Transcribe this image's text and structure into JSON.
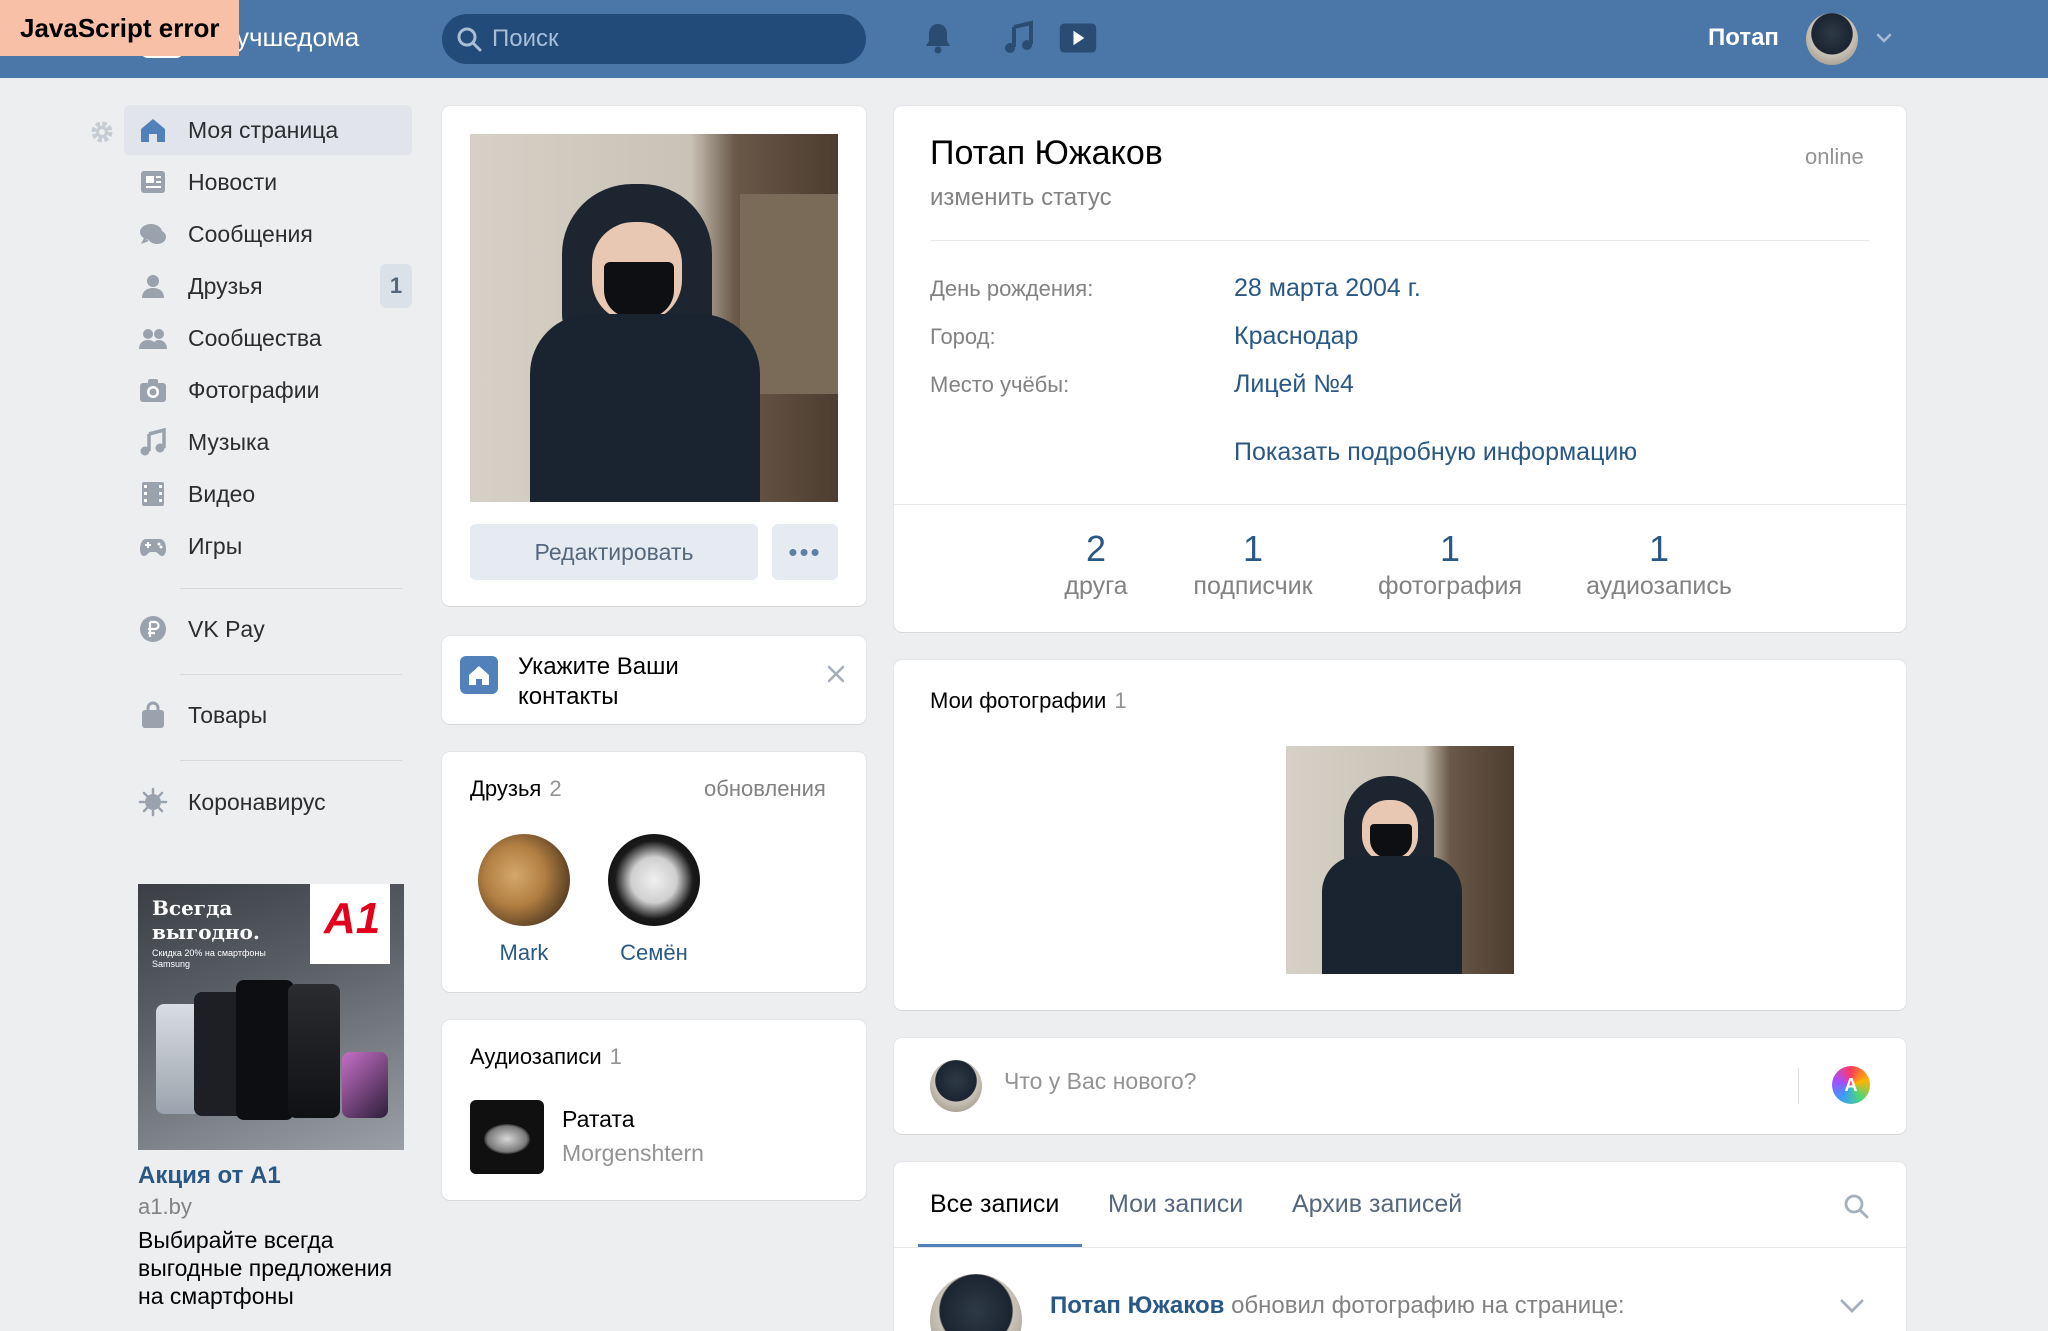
{
  "error_badge": "JavaScript error",
  "header": {
    "logo_text": "учшедома",
    "search_placeholder": "Поиск",
    "user_name": "Потап"
  },
  "nav": {
    "items": [
      {
        "label": "Моя страница",
        "icon": "home-icon",
        "active": true
      },
      {
        "label": "Новости",
        "icon": "news-icon"
      },
      {
        "label": "Сообщения",
        "icon": "messages-icon"
      },
      {
        "label": "Друзья",
        "icon": "friends-icon",
        "badge": "1"
      },
      {
        "label": "Сообщества",
        "icon": "groups-icon"
      },
      {
        "label": "Фотографии",
        "icon": "camera-icon"
      },
      {
        "label": "Музыка",
        "icon": "music-icon"
      },
      {
        "label": "Видео",
        "icon": "video-icon"
      },
      {
        "label": "Игры",
        "icon": "gamepad-icon"
      },
      {
        "label": "VK Pay",
        "icon": "ruble-icon"
      },
      {
        "label": "Товары",
        "icon": "bag-icon"
      },
      {
        "label": "Коронавирус",
        "icon": "virus-icon"
      }
    ]
  },
  "ad": {
    "headline": "Всегда выгодно.",
    "subline": "Скидка 20% на смартфоны Samsung",
    "brand": "A1",
    "title": "Акция от А1",
    "domain": "a1.by",
    "description": "Выбирайте всегда выгодные предложения на смартфоны"
  },
  "profile_card": {
    "edit_label": "Редактировать",
    "more_label": "•••"
  },
  "contacts_prompt": "Укажите Ваши контакты",
  "friends": {
    "title": "Друзья",
    "count": "2",
    "link": "обновления",
    "list": [
      {
        "name": "Mark"
      },
      {
        "name": "Семён"
      }
    ]
  },
  "audio": {
    "title": "Аудиозаписи",
    "count": "1",
    "track": "Ратата",
    "artist": "Morgenshtern"
  },
  "profile": {
    "name": "Потап Южаков",
    "status": "изменить статус",
    "online": "online",
    "birthday_label": "День рождения:",
    "birthday": "28 марта 2004 г.",
    "city_label": "Город:",
    "city": "Краснодар",
    "school_label": "Место учёбы:",
    "school": "Лицей №4",
    "show_more": "Показать подробную информацию"
  },
  "counters": [
    {
      "value": "2",
      "label": "друга"
    },
    {
      "value": "1",
      "label": "подписчик"
    },
    {
      "value": "1",
      "label": "фотография"
    },
    {
      "value": "1",
      "label": "аудиозапись"
    }
  ],
  "photos": {
    "title": "Мои фотографии",
    "count": "1"
  },
  "composer": {
    "placeholder": "Что у Вас нового?",
    "icon_letter": "A"
  },
  "wall": {
    "tabs": [
      "Все записи",
      "Мои записи",
      "Архив записей"
    ],
    "post_author": "Потап Южаков",
    "post_action": "обновил фотографию на странице:"
  },
  "colors": {
    "header": "#4a76a8",
    "link": "#2a5885",
    "accent": "#5181b8"
  }
}
